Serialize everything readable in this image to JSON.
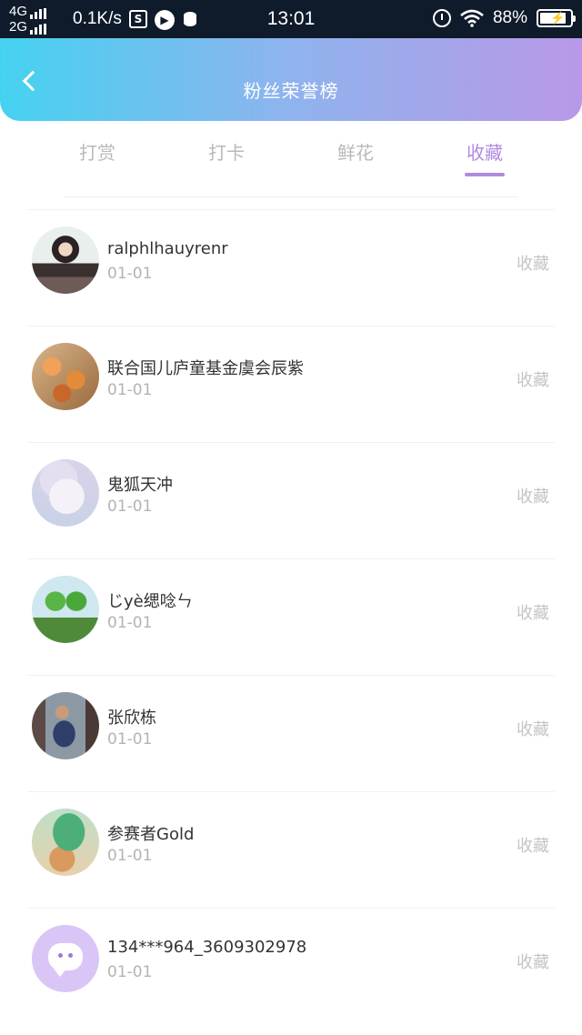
{
  "status_bar": {
    "network_top": "4G",
    "network_bottom": "2G",
    "speed": "0.1K/s",
    "time": "13:01",
    "battery": "88%",
    "battery_level": 0.88
  },
  "header": {
    "title": "粉丝荣誉榜"
  },
  "tabs": [
    {
      "label": "打赏",
      "active": false
    },
    {
      "label": "打卡",
      "active": false
    },
    {
      "label": "鲜花",
      "active": false
    },
    {
      "label": "收藏",
      "active": true
    }
  ],
  "list": [
    {
      "name": "ralphlhauyrenr",
      "date": "01-01",
      "action": "收藏"
    },
    {
      "name": "联合国儿庐童基金虞会辰紫",
      "date": "01-01",
      "action": "收藏"
    },
    {
      "name": "鬼狐天冲",
      "date": "01-01",
      "action": "收藏"
    },
    {
      "name": "じyè缌唸ㄣ",
      "date": "01-01",
      "action": "收藏"
    },
    {
      "name": "张欣栋",
      "date": "01-01",
      "action": "收藏"
    },
    {
      "name": "参赛者Gold",
      "date": "01-01",
      "action": "收藏"
    },
    {
      "name": "134***964_3609302978",
      "date": "01-01",
      "action": "收藏"
    }
  ],
  "colors": {
    "accent": "#b08ae0",
    "header_gradient_start": "#45d2f0",
    "header_gradient_end": "#b998e8"
  }
}
